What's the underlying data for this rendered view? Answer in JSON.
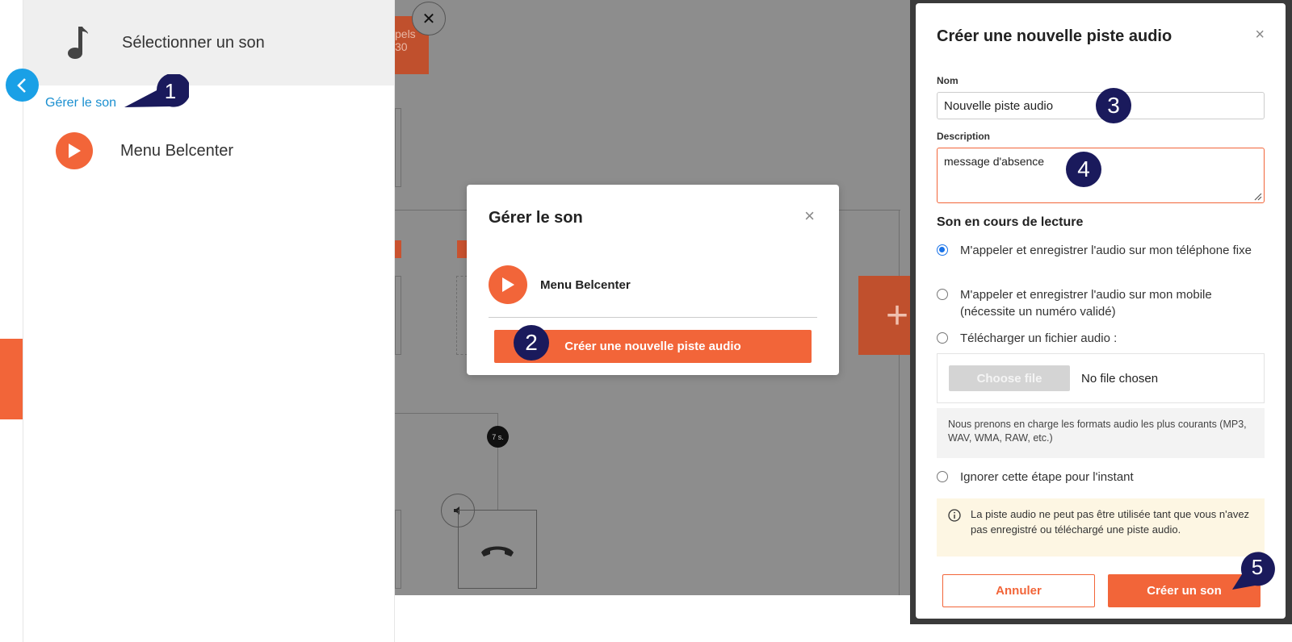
{
  "left_panel": {
    "header_title": "Sélectionner un son",
    "manage_link": "Gérer le son",
    "sound_item": "Menu Belcenter"
  },
  "canvas": {
    "top_card_line1": "pels",
    "top_card_line2": "30",
    "timer_label": "7 s.",
    "plus_label": "+"
  },
  "manage_modal": {
    "title": "Gérer le son",
    "close": "×",
    "sound_item": "Menu Belcenter",
    "create_button": "Créer une nouvelle piste audio"
  },
  "create_dialog": {
    "title": "Créer une nouvelle piste audio",
    "close": "×",
    "name_label": "Nom",
    "name_value": "Nouvelle piste audio",
    "description_label": "Description",
    "description_value": "message d'absence",
    "section_title": "Son en cours de lecture",
    "options": [
      {
        "label": "M'appeler et enregistrer l'audio sur mon téléphone fixe",
        "checked": true
      },
      {
        "label": "M'appeler et enregistrer l'audio sur mon mobile (nécessite un numéro validé)",
        "checked": false
      },
      {
        "label": "Télécharger un fichier audio :",
        "checked": false
      },
      {
        "label": "Ignorer cette étape pour l'instant",
        "checked": false
      }
    ],
    "choose_file": "Choose file",
    "no_file": "No file chosen",
    "formats_note": "Nous prenons en charge les formats audio les plus courants (MP3, WAV, WMA, RAW, etc.)",
    "warning": "La piste audio ne peut pas être utilisée tant que vous n'avez pas enregistré ou téléchargé une piste audio.",
    "cancel_button": "Annuler",
    "create_button": "Créer un son"
  },
  "annotations": {
    "step1": "1",
    "step2": "2",
    "step3": "3",
    "step4": "4",
    "step5": "5"
  },
  "colors": {
    "accent": "#f26539",
    "link": "#1a8fd0",
    "badge": "#1a1a5c",
    "overlay": "#8d8d8d"
  }
}
